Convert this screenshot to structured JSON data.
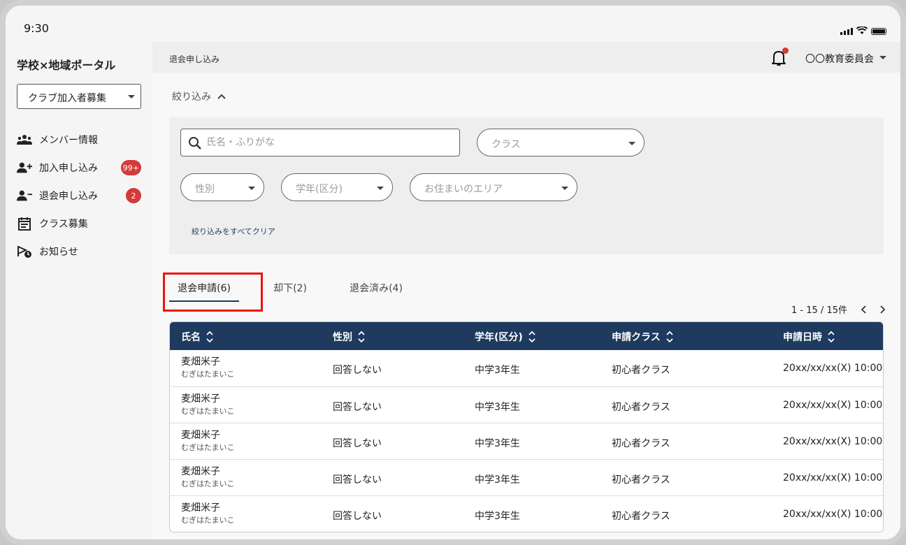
{
  "status_bar": {
    "time": "9:30"
  },
  "app": {
    "title": "学校×地域ポータル"
  },
  "sidebar": {
    "club_select": "クラブ加入者募集",
    "items": [
      {
        "label": "メンバー情報",
        "icon": "group-icon"
      },
      {
        "label": "加入申し込み",
        "icon": "person-add-icon",
        "badge": "99+"
      },
      {
        "label": "退会申し込み",
        "icon": "person-remove-icon",
        "badge": "2"
      },
      {
        "label": "クラス募集",
        "icon": "calendar-icon"
      },
      {
        "label": "お知らせ",
        "icon": "announcement-icon"
      }
    ]
  },
  "header": {
    "breadcrumb": "退会申し込み",
    "org": "〇〇教育委員会"
  },
  "filters": {
    "toggle_label": "絞り込み",
    "search_placeholder": "氏名・ふりがな",
    "class_placeholder": "クラス",
    "gender_placeholder": "性別",
    "grade_placeholder": "学年(区分)",
    "area_placeholder": "お住まいのエリア",
    "clear_label": "絞り込みをすべてクリア"
  },
  "tabs": [
    {
      "label": "退会申請(6)",
      "active": true
    },
    {
      "label": "却下(2)"
    },
    {
      "label": "退会済み(4)"
    }
  ],
  "pagination": {
    "text": "1 - 15 / 15件"
  },
  "table": {
    "headers": [
      "氏名",
      "性別",
      "学年(区分)",
      "申請クラス",
      "申請日時"
    ],
    "rows": [
      {
        "name": "麦畑米子",
        "kana": "むぎはたまいこ",
        "gender": "回答しない",
        "grade": "中学3年生",
        "class": "初心者クラス",
        "date": "20xx/xx/xx(X) 10:00"
      },
      {
        "name": "麦畑米子",
        "kana": "むぎはたまいこ",
        "gender": "回答しない",
        "grade": "中学3年生",
        "class": "初心者クラス",
        "date": "20xx/xx/xx(X) 10:00"
      },
      {
        "name": "麦畑米子",
        "kana": "むぎはたまいこ",
        "gender": "回答しない",
        "grade": "中学3年生",
        "class": "初心者クラス",
        "date": "20xx/xx/xx(X) 10:00"
      },
      {
        "name": "麦畑米子",
        "kana": "むぎはたまいこ",
        "gender": "回答しない",
        "grade": "中学3年生",
        "class": "初心者クラス",
        "date": "20xx/xx/xx(X) 10:00"
      },
      {
        "name": "麦畑米子",
        "kana": "むぎはたまいこ",
        "gender": "回答しない",
        "grade": "中学3年生",
        "class": "初心者クラス",
        "date": "20xx/xx/xx(X) 10:00"
      }
    ]
  },
  "colors": {
    "navy": "#1e3a5f",
    "badge_red": "#d33a3a",
    "highlight_red": "#e11111"
  }
}
